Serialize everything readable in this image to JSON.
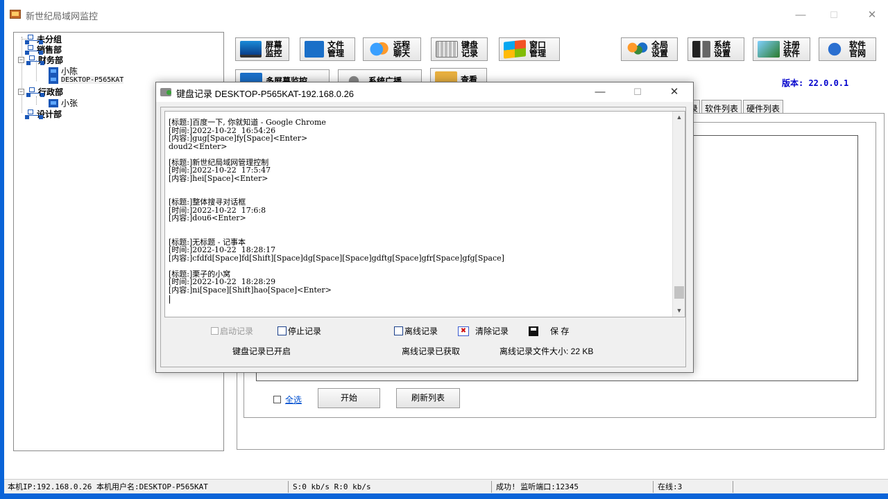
{
  "window": {
    "title": "新世纪局域网监控",
    "controls": {
      "minimize": "—",
      "maximize": "☐",
      "close": "✕"
    }
  },
  "tree": {
    "items": [
      {
        "label": "未分组",
        "type": "group"
      },
      {
        "label": "销售部",
        "type": "group"
      },
      {
        "label": "财务部",
        "type": "group",
        "expanded": true
      },
      {
        "label": "小陈",
        "type": "pc"
      },
      {
        "label": "DESKTOP-P565KAT",
        "type": "pc",
        "selected": true
      },
      {
        "label": "行政部",
        "type": "group",
        "expanded": true
      },
      {
        "label": "小张",
        "type": "pc"
      },
      {
        "label": "设计部",
        "type": "group"
      }
    ]
  },
  "toolbar": {
    "screen_monitor": "屏幕监控",
    "file_manage": "文件管理",
    "remote_chat": "远程聊天",
    "keyboard_log": "键盘记录",
    "window_manage": "窗口管理",
    "global_settings": "全局设置",
    "system_settings": "系统设置",
    "register_software": "注册软件",
    "software_website": "软件官网",
    "multi_screen": "多屏幕监控",
    "system_broadcast": "系统广播",
    "view": "查看"
  },
  "version": "版本: 22.0.0.1",
  "tabs": {
    "partial": "录",
    "software_list": "软件列表",
    "hardware_list": "硬件列表"
  },
  "panel": {
    "select_all": "全选",
    "start_button": "开始",
    "refresh_button": "刷新列表"
  },
  "statusbar": {
    "local_ip": "本机IP:192.168.0.26  本机用户名:DESKTOP-P565KAT",
    "speed": "S:0 kb/s R:0 kb/s",
    "listen": "成功! 监听端口:12345",
    "online": "在线:3"
  },
  "dialog": {
    "title": "键盘记录 DESKTOP-P565KAT-192.168.0.26",
    "controls": {
      "minimize": "—",
      "maximize": "☐",
      "close": "✕"
    },
    "log_lines": [
      "[标题:]百度一下, 你就知道 - Google Chrome",
      "[时间:]2022-10-22  16:54:26",
      "[内容:]gug[Space]fy[Space]<Enter>",
      "doud2<Enter>",
      "",
      "[标题:]新世纪局域网管理控制",
      "[时间:]2022-10-22  17:5:47",
      "[内容:]hei[Space]<Enter>",
      "",
      "",
      "[标题:]整体搜寻对话框",
      "[时间:]2022-10-22  17:6:8",
      "[内容:]dou6<Enter>",
      "",
      "",
      "[标题:]无标题 - 记事本",
      "[时间:]2022-10-22  18:28:17",
      "[内容:]cfdfd[Space]fd[Shift][Space]dg[Space][Space]gdftg[Space]gfr[Space]gfg[Space]",
      "",
      "[标题:]栗子的小窝",
      "[时间:]2022-10-22  18:28:29",
      "[内容:]ni[Space][Shift]hao[Space]<Enter>"
    ],
    "start_record": "启动记录",
    "stop_record": "停止记录",
    "offline_record": "离线记录",
    "clear_record": "清除记录",
    "save": "保  存",
    "status_enabled": "键盘记录已开启",
    "status_offline": "离线记录已获取",
    "status_filesize": "离线记录文件大小: 22 KB"
  }
}
